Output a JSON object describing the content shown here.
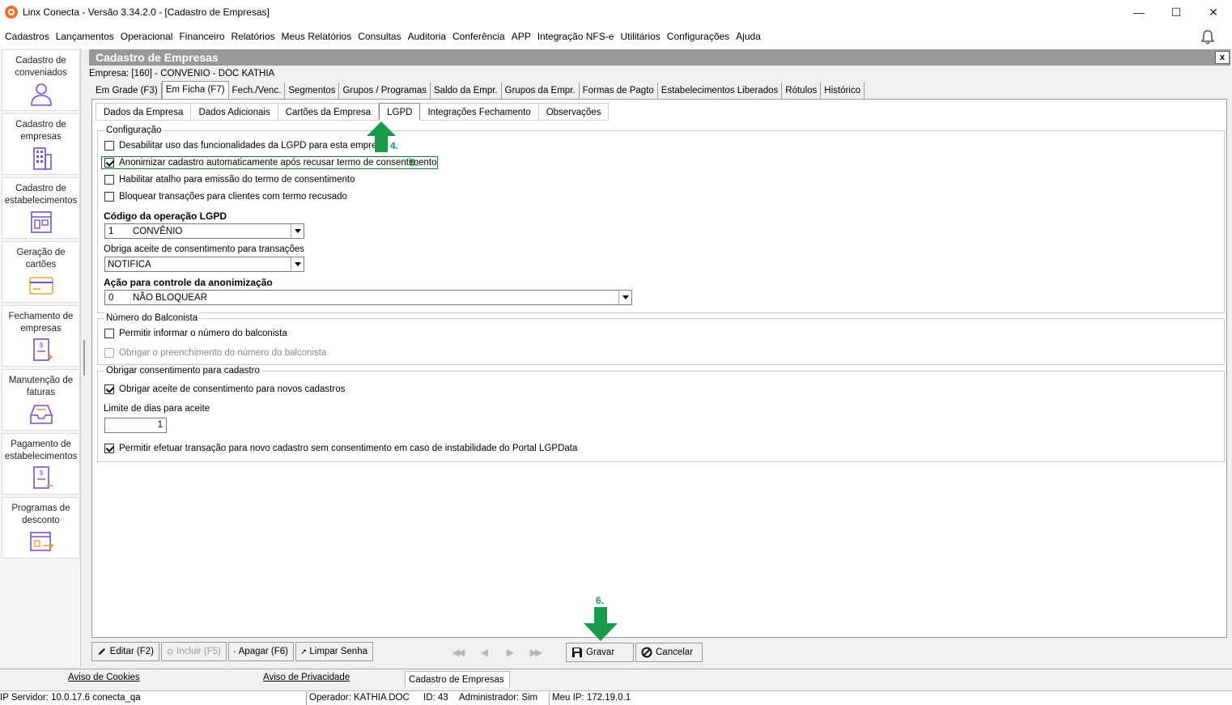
{
  "window": {
    "title": "Linx Conecta - Versão 3.34.2.0 - [Cadastro de Empresas]",
    "minimize": "—",
    "maximize": "☐",
    "close": "✕"
  },
  "menu": [
    "Cadastros",
    "Lançamentos",
    "Operacional",
    "Financeiro",
    "Relatórios",
    "Meus Relatórios",
    "Consultas",
    "Auditoria",
    "Conferência",
    "APP",
    "Integração NFS-e",
    "Utilitários",
    "Configurações",
    "Ajuda"
  ],
  "sidebar": [
    {
      "label": "Cadastro de conveniados",
      "icon": "user-icon"
    },
    {
      "label": "Cadastro de empresas",
      "icon": "building-icon"
    },
    {
      "label": "Cadastro de estabelecimentos",
      "icon": "store-icon"
    },
    {
      "label": "Geração de cartões",
      "icon": "card-icon"
    },
    {
      "label": "Fechamento de empresas",
      "icon": "invoice-icon"
    },
    {
      "label": "Manutenção de faturas",
      "icon": "tray-icon"
    },
    {
      "label": "Pagamento de estabelecimentos",
      "icon": "payment-icon"
    },
    {
      "label": "Programas de desconto",
      "icon": "discount-icon"
    }
  ],
  "form": {
    "title": "Cadastro de Empresas",
    "close": "x",
    "company": "Empresa: [160] - CONVENIO - DOC KATHIA",
    "tabs": [
      "Em Grade (F3)",
      "Em Ficha (F7)",
      "Fech./Venc.",
      "Segmentos",
      "Grupos / Programas",
      "Saldo da Empr.",
      "Grupos da Empr.",
      "Formas de Pagto",
      "Estabelecimentos Liberados",
      "Rótulos",
      "Histórico"
    ],
    "active_tab": "Em Ficha (F7)",
    "subtabs": [
      "Dados da Empresa",
      "Dados Adicionais",
      "Cartões da Empresa",
      "LGPD",
      "Integrações Fechamento",
      "Observações"
    ],
    "active_subtab": "LGPD"
  },
  "config": {
    "legend": "Configuração",
    "opt1": "Desabilitar uso das funcionalidades da LGPD para esta empresa",
    "opt2": "Anonimizar cadastro automaticamente após recusar termo de consentimento",
    "opt3": "Habilitar atalho para emissão do termo de consentimento",
    "opt4": "Bloquear transações para clientes com termo recusado",
    "codigo_label": "Código da operação LGPD",
    "codigo_code": "1",
    "codigo_value": "CONVÊNIO",
    "obriga_label": "Obriga aceite de consentimento para transações",
    "obriga_value": "NOTIFICA",
    "acao_label": "Ação para controle da anonimização",
    "acao_code": "0",
    "acao_value": "NÃO BLOQUEAR"
  },
  "balconista": {
    "legend": "Número do Balconista",
    "opt1": "Permitir informar o número do balconista",
    "opt2": "Obrigar o preenchimento do número do balconista"
  },
  "consent": {
    "legend": "Obrigar consentimento para cadastro",
    "opt1": "Obrigar aceite de consentimento para novos cadastros",
    "limite_label": "Limite de dias para aceite",
    "limite_value": "1",
    "opt2": "Permitir efetuar transação para novo cadastro sem consentimento em caso de instabilidade do Portal LGPData"
  },
  "annotations": {
    "a4": "4.",
    "a5": "5.",
    "a6": "6."
  },
  "toolbar": {
    "editar": "Editar (F2)",
    "incluir": "Incluir (F5)",
    "apagar": "Apagar (F6)",
    "limpar": "Limpar Senha",
    "gravar": "Gravar",
    "cancelar": "Cancelar"
  },
  "footer": {
    "cookies": "Aviso de Cookies",
    "privacidade": "Aviso de Privacidade",
    "cadastro": "Cadastro de Empresas"
  },
  "status": {
    "servidor": "IP Servidor: 10.0.17.6 conecta_qa",
    "operador": "Operador: KATHIA DOC",
    "id": "ID: 43",
    "admin": "Administrador: Sim",
    "ip": "Meu IP: 172.19.0.1"
  },
  "colors": {
    "accent_annotation": "#1a9b4a",
    "sidebar_icon": "#7b4fc4",
    "app_logo": "#e8702a"
  }
}
